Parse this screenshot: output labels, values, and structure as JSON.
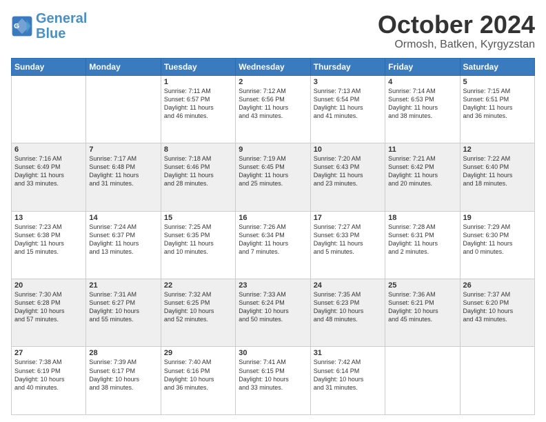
{
  "header": {
    "logo_line1": "General",
    "logo_line2": "Blue",
    "month": "October 2024",
    "location": "Ormosh, Batken, Kyrgyzstan"
  },
  "weekdays": [
    "Sunday",
    "Monday",
    "Tuesday",
    "Wednesday",
    "Thursday",
    "Friday",
    "Saturday"
  ],
  "weeks": [
    [
      {
        "day": "",
        "info": ""
      },
      {
        "day": "",
        "info": ""
      },
      {
        "day": "1",
        "info": "Sunrise: 7:11 AM\nSunset: 6:57 PM\nDaylight: 11 hours\nand 46 minutes."
      },
      {
        "day": "2",
        "info": "Sunrise: 7:12 AM\nSunset: 6:56 PM\nDaylight: 11 hours\nand 43 minutes."
      },
      {
        "day": "3",
        "info": "Sunrise: 7:13 AM\nSunset: 6:54 PM\nDaylight: 11 hours\nand 41 minutes."
      },
      {
        "day": "4",
        "info": "Sunrise: 7:14 AM\nSunset: 6:53 PM\nDaylight: 11 hours\nand 38 minutes."
      },
      {
        "day": "5",
        "info": "Sunrise: 7:15 AM\nSunset: 6:51 PM\nDaylight: 11 hours\nand 36 minutes."
      }
    ],
    [
      {
        "day": "6",
        "info": "Sunrise: 7:16 AM\nSunset: 6:49 PM\nDaylight: 11 hours\nand 33 minutes."
      },
      {
        "day": "7",
        "info": "Sunrise: 7:17 AM\nSunset: 6:48 PM\nDaylight: 11 hours\nand 31 minutes."
      },
      {
        "day": "8",
        "info": "Sunrise: 7:18 AM\nSunset: 6:46 PM\nDaylight: 11 hours\nand 28 minutes."
      },
      {
        "day": "9",
        "info": "Sunrise: 7:19 AM\nSunset: 6:45 PM\nDaylight: 11 hours\nand 25 minutes."
      },
      {
        "day": "10",
        "info": "Sunrise: 7:20 AM\nSunset: 6:43 PM\nDaylight: 11 hours\nand 23 minutes."
      },
      {
        "day": "11",
        "info": "Sunrise: 7:21 AM\nSunset: 6:42 PM\nDaylight: 11 hours\nand 20 minutes."
      },
      {
        "day": "12",
        "info": "Sunrise: 7:22 AM\nSunset: 6:40 PM\nDaylight: 11 hours\nand 18 minutes."
      }
    ],
    [
      {
        "day": "13",
        "info": "Sunrise: 7:23 AM\nSunset: 6:38 PM\nDaylight: 11 hours\nand 15 minutes."
      },
      {
        "day": "14",
        "info": "Sunrise: 7:24 AM\nSunset: 6:37 PM\nDaylight: 11 hours\nand 13 minutes."
      },
      {
        "day": "15",
        "info": "Sunrise: 7:25 AM\nSunset: 6:35 PM\nDaylight: 11 hours\nand 10 minutes."
      },
      {
        "day": "16",
        "info": "Sunrise: 7:26 AM\nSunset: 6:34 PM\nDaylight: 11 hours\nand 7 minutes."
      },
      {
        "day": "17",
        "info": "Sunrise: 7:27 AM\nSunset: 6:33 PM\nDaylight: 11 hours\nand 5 minutes."
      },
      {
        "day": "18",
        "info": "Sunrise: 7:28 AM\nSunset: 6:31 PM\nDaylight: 11 hours\nand 2 minutes."
      },
      {
        "day": "19",
        "info": "Sunrise: 7:29 AM\nSunset: 6:30 PM\nDaylight: 11 hours\nand 0 minutes."
      }
    ],
    [
      {
        "day": "20",
        "info": "Sunrise: 7:30 AM\nSunset: 6:28 PM\nDaylight: 10 hours\nand 57 minutes."
      },
      {
        "day": "21",
        "info": "Sunrise: 7:31 AM\nSunset: 6:27 PM\nDaylight: 10 hours\nand 55 minutes."
      },
      {
        "day": "22",
        "info": "Sunrise: 7:32 AM\nSunset: 6:25 PM\nDaylight: 10 hours\nand 52 minutes."
      },
      {
        "day": "23",
        "info": "Sunrise: 7:33 AM\nSunset: 6:24 PM\nDaylight: 10 hours\nand 50 minutes."
      },
      {
        "day": "24",
        "info": "Sunrise: 7:35 AM\nSunset: 6:23 PM\nDaylight: 10 hours\nand 48 minutes."
      },
      {
        "day": "25",
        "info": "Sunrise: 7:36 AM\nSunset: 6:21 PM\nDaylight: 10 hours\nand 45 minutes."
      },
      {
        "day": "26",
        "info": "Sunrise: 7:37 AM\nSunset: 6:20 PM\nDaylight: 10 hours\nand 43 minutes."
      }
    ],
    [
      {
        "day": "27",
        "info": "Sunrise: 7:38 AM\nSunset: 6:19 PM\nDaylight: 10 hours\nand 40 minutes."
      },
      {
        "day": "28",
        "info": "Sunrise: 7:39 AM\nSunset: 6:17 PM\nDaylight: 10 hours\nand 38 minutes."
      },
      {
        "day": "29",
        "info": "Sunrise: 7:40 AM\nSunset: 6:16 PM\nDaylight: 10 hours\nand 36 minutes."
      },
      {
        "day": "30",
        "info": "Sunrise: 7:41 AM\nSunset: 6:15 PM\nDaylight: 10 hours\nand 33 minutes."
      },
      {
        "day": "31",
        "info": "Sunrise: 7:42 AM\nSunset: 6:14 PM\nDaylight: 10 hours\nand 31 minutes."
      },
      {
        "day": "",
        "info": ""
      },
      {
        "day": "",
        "info": ""
      }
    ]
  ]
}
